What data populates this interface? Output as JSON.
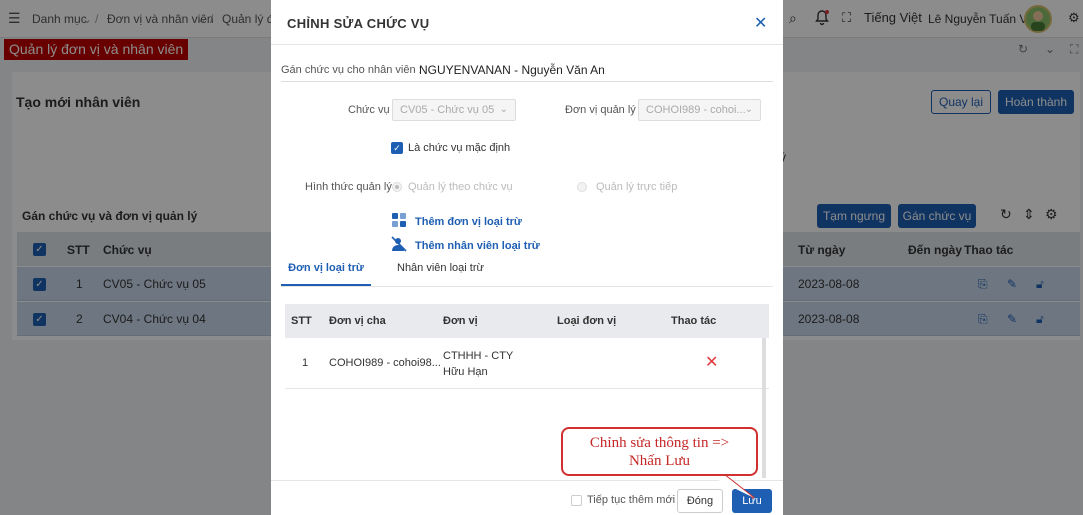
{
  "topbar": {
    "breadcrumb": [
      "Danh mục",
      "Đơn vị và nhân viên",
      "Quản lý đơ"
    ],
    "language": "Tiếng Việt",
    "user_name": "Lê Nguyễn Tuấn Vũ"
  },
  "page_badge": "Quản lý đơn vị và nhân viên",
  "background": {
    "title": "Tạo mới nhân viên",
    "back_button": "Quay lại",
    "complete_button": "Hoàn thành",
    "section_title": "Gán chức vụ và đơn vị quản lý",
    "suspend_button": "Tạm ngưng",
    "assign_button": "Gán chức vụ",
    "stray_char": "ý",
    "table": {
      "headers": [
        "STT",
        "Chức vụ",
        "Từ ngày",
        "Đến ngày",
        "Thao tác"
      ],
      "rows": [
        {
          "stt": "1",
          "position": "CV05 - Chức vụ 05",
          "from": "2023-08-08"
        },
        {
          "stt": "2",
          "position": "CV04 - Chức vụ 04",
          "from": "2023-08-08"
        }
      ]
    }
  },
  "modal": {
    "title": "CHỈNH SỬA CHỨC VỤ",
    "assign_label": "Gán chức vụ cho nhân viên :",
    "assign_value": "NGUYENVANAN - Nguyễn Văn An",
    "position_label": "Chức vụ",
    "position_value": "CV05 - Chức vụ 05",
    "unit_label": "Đơn vị quản lý",
    "unit_value": "COHOI989 - cohoi...",
    "default_label": "Là chức vụ mặc định",
    "mgmt_label": "Hình thức quản lý",
    "radio_by_position": "Quản lý theo chức vụ",
    "radio_direct": "Quản lý trực tiếp",
    "add_excluded_unit": "Thêm đơn vị loại trừ",
    "add_excluded_employee": "Thêm nhân viên loại trừ",
    "tab_units": "Đơn vị loại trừ",
    "tab_employees": "Nhân viên loại trừ",
    "table": {
      "headers": [
        "STT",
        "Đơn vị cha",
        "Đơn vị",
        "Loại đơn vị",
        "Thao tác"
      ],
      "rows": [
        {
          "stt": "1",
          "parent": "COHOI989 - cohoi98...",
          "unit": "CTHHH - CTY Hữu Hạn",
          "type": ""
        }
      ]
    },
    "continue_label": "Tiếp tục thêm mới",
    "close_button": "Đóng",
    "save_button": "Lưu"
  },
  "callout": {
    "line1": "Chỉnh sửa thông tin =>",
    "line2": "Nhấn Lưu"
  },
  "colors": {
    "primary": "#1e5fb3",
    "danger": "#e0393e",
    "badge": "#c00000"
  }
}
